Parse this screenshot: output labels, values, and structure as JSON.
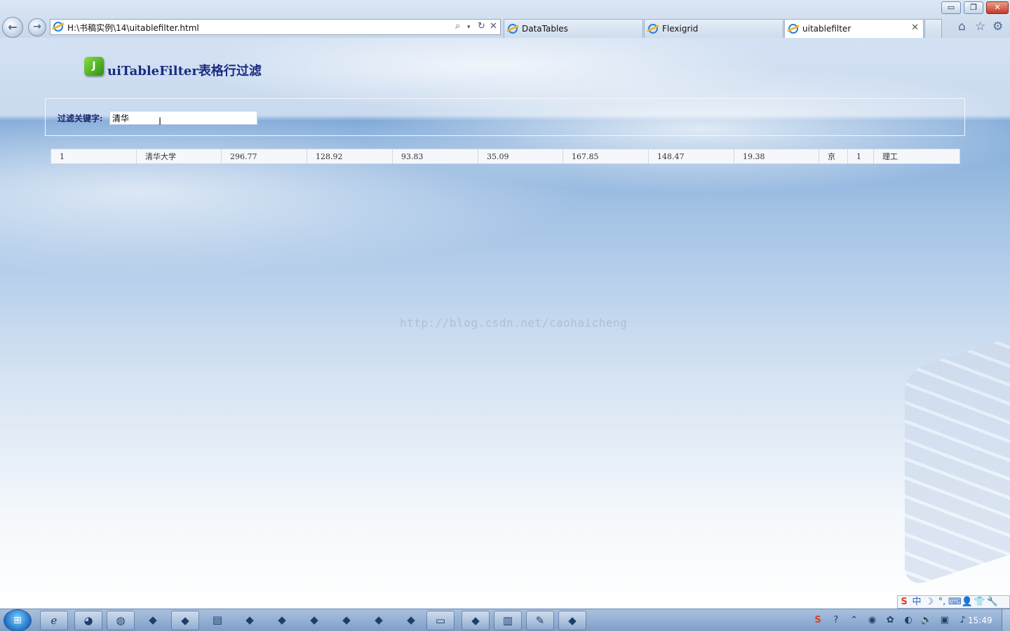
{
  "window": {
    "minimize_label": "▭",
    "restore_label": "❐",
    "close_label": "✕"
  },
  "browser": {
    "address": "H:\\书稿实例\\14\\uitablefilter.html",
    "tabs": [
      {
        "label": "DataTables",
        "active": false
      },
      {
        "label": "Flexigrid",
        "active": false
      },
      {
        "label": "uitablefilter",
        "active": true
      }
    ],
    "tab_close_glyph": "✕",
    "icons": {
      "back": "back-icon",
      "forward": "forward-icon",
      "search": "search-icon",
      "refresh": "refresh-icon",
      "stop": "stop-icon",
      "home": "home-icon",
      "favorites": "star-icon",
      "tools": "gear-icon"
    }
  },
  "page": {
    "title": "uiTableFilter表格行过滤",
    "filter": {
      "label": "过滤关键字:",
      "value": "清华"
    },
    "table": {
      "rows": [
        [
          "1",
          "清华大学",
          "296.77",
          "128.92",
          "93.83",
          "35.09",
          "167.85",
          "148.47",
          "19.38",
          "京",
          "1",
          "理工"
        ]
      ]
    },
    "watermark": "http://blog.csdn.net/caohaicheng"
  },
  "ime_bar": [
    "S",
    "中",
    "☽",
    "°,",
    "⌨",
    "👤",
    "👕",
    "🔧"
  ],
  "taskbar": {
    "start_glyph": "⊞",
    "clock": "15:49",
    "apps": [
      "ie-icon",
      "chrome-icon",
      "firefox-icon",
      "app-icon",
      "app-icon",
      "notepad-icon",
      "app-icon",
      "app-icon",
      "app-icon",
      "app-icon",
      "app-icon",
      "app-icon",
      "explorer-icon",
      "app-icon",
      "pdf-icon",
      "editor-icon",
      "app-icon"
    ]
  },
  "colors": {
    "title": "#1a2c80",
    "filter_label": "#1b2670",
    "logo_green": "#2f8f12"
  }
}
